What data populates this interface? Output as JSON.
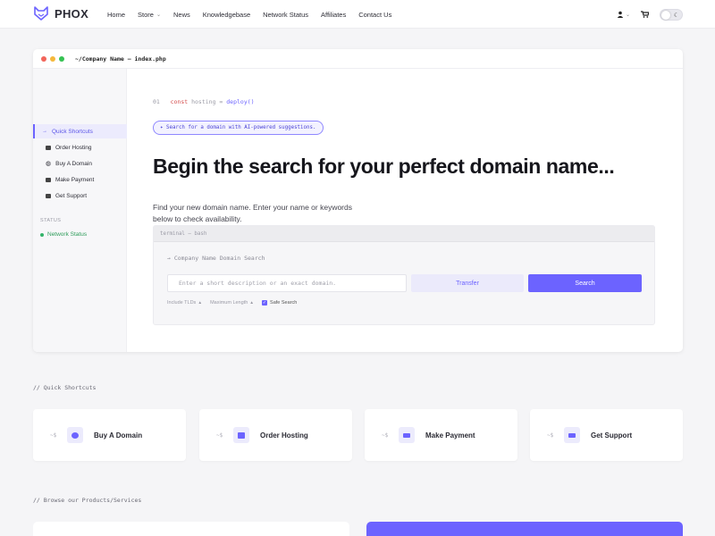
{
  "brand": {
    "name": "PHOX",
    "accent": "#6c63ff"
  },
  "nav": {
    "links": [
      {
        "label": "Home",
        "dropdown": false
      },
      {
        "label": "Store",
        "dropdown": true
      },
      {
        "label": "News",
        "dropdown": false
      },
      {
        "label": "Knowledgebase",
        "dropdown": false
      },
      {
        "label": "Network Status",
        "dropdown": false
      },
      {
        "label": "Affiliates",
        "dropdown": false
      },
      {
        "label": "Contact Us",
        "dropdown": false
      }
    ],
    "right": {
      "account_icon": "user-icon",
      "cart_icon": "cart-icon",
      "theme_toggle_icon": "moon-icon"
    }
  },
  "window": {
    "title": "~/Company Name — index.php",
    "sidebar": {
      "items": [
        {
          "label": "Quick Shortcuts",
          "icon": "arrow-icon",
          "active": true
        },
        {
          "label": "Order Hosting",
          "icon": "server-icon"
        },
        {
          "label": "Buy A Domain",
          "icon": "globe-icon"
        },
        {
          "label": "Make Payment",
          "icon": "card-icon"
        },
        {
          "label": "Get Support",
          "icon": "support-icon"
        }
      ],
      "status_label": "STATUS",
      "status_item": "Network Status"
    },
    "code": {
      "line_no": "01",
      "keyword": "const",
      "identifier": "hosting",
      "op": "=",
      "fn": "deploy()"
    },
    "ai_pill": "✦ Search for a domain with AI-powered suggestions.",
    "headline": "Begin the search for your perfect domain name...",
    "subtext": "Find your new domain name. Enter your name or keywords below to check availability.",
    "terminal": {
      "header": "terminal — bash",
      "label": "→ Company Name Domain Search",
      "input_placeholder": "Enter a short description or an exact domain.",
      "transfer_label": "Transfer",
      "search_label": "Search",
      "options": {
        "tlds": "Include TLDs",
        "max_length": "Maximum Length",
        "safe_search": "Safe Search"
      }
    }
  },
  "quick_shortcuts": {
    "label": "// Quick Shortcuts",
    "arrow": "~$",
    "items": [
      {
        "label": "Buy A Domain",
        "icon": "globe-icon"
      },
      {
        "label": "Order Hosting",
        "icon": "server-icon"
      },
      {
        "label": "Make Payment",
        "icon": "card-icon"
      },
      {
        "label": "Get Support",
        "icon": "support-icon"
      }
    ]
  },
  "products": {
    "label": "// Browse our Products/Services"
  }
}
